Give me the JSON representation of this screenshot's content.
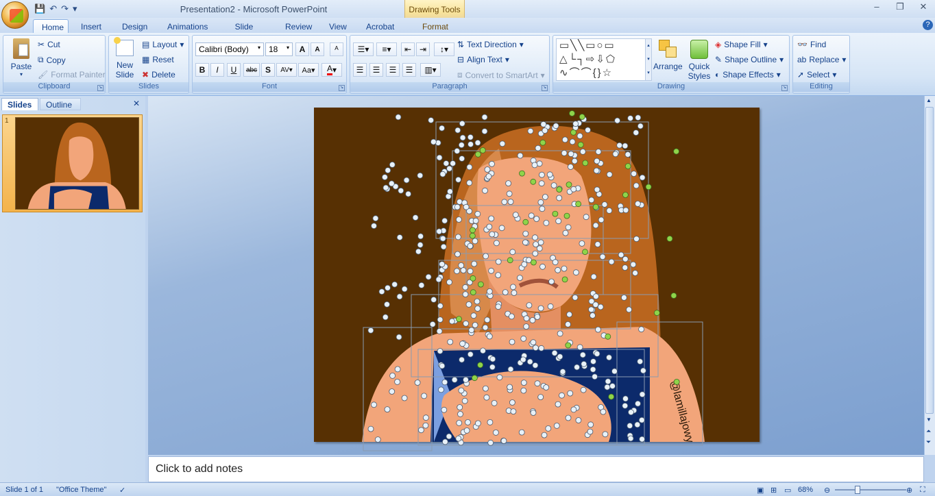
{
  "window": {
    "title": "Presentation2 - Microsoft PowerPoint",
    "context_tab_group": "Drawing Tools"
  },
  "tabs": [
    "Home",
    "Insert",
    "Design",
    "Animations",
    "Slide Show",
    "Review",
    "View",
    "Acrobat",
    "Format"
  ],
  "active_tab": "Home",
  "ribbon": {
    "clipboard": {
      "label": "Clipboard",
      "paste": "Paste",
      "cut": "Cut",
      "copy": "Copy",
      "format_painter": "Format Painter"
    },
    "slides": {
      "label": "Slides",
      "new_slide": "New",
      "new_slide2": "Slide",
      "layout": "Layout",
      "reset": "Reset",
      "delete": "Delete"
    },
    "font": {
      "label": "Font",
      "font_name": "Calibri (Body)",
      "font_size": "18"
    },
    "paragraph": {
      "label": "Paragraph",
      "text_direction": "Text Direction",
      "align_text": "Align Text",
      "convert_smartart": "Convert to SmartArt"
    },
    "drawing": {
      "label": "Drawing",
      "arrange": "Arrange",
      "quick_styles": "Quick",
      "quick_styles2": "Styles",
      "shape_fill": "Shape Fill",
      "shape_outline": "Shape Outline",
      "shape_effects": "Shape Effects"
    },
    "editing": {
      "label": "Editing",
      "find": "Find",
      "replace": "Replace",
      "select": "Select"
    }
  },
  "panel": {
    "tab_slides": "Slides",
    "tab_outline": "Outline",
    "slide_number": "1"
  },
  "slide": {
    "watermark": "@lamillajowy"
  },
  "notes_placeholder": "Click to add notes",
  "status": {
    "slide": "Slide 1 of 1",
    "theme": "\"Office Theme\"",
    "zoom": "68%"
  },
  "colors": {
    "slide_bg": "#573003",
    "hair": "#b9651e",
    "skin": "#f2a57a",
    "shirt": "#0c2a6b",
    "selection_handle": "#e8f1f8",
    "rotation_handle": "#8fd44a"
  }
}
